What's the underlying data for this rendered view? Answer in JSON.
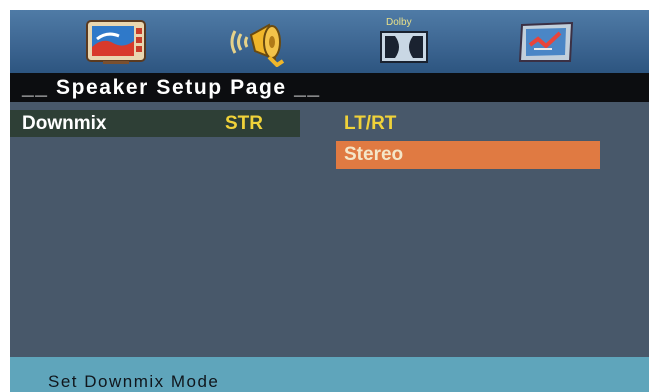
{
  "tabs": [
    {
      "name": "general-setup",
      "icon": "tv-icon"
    },
    {
      "name": "audio-setup",
      "icon": "speaker-icon"
    },
    {
      "name": "dolby-setup",
      "icon": "dolby-icon",
      "label": "Dolby"
    },
    {
      "name": "preference-setup",
      "icon": "checklist-icon"
    }
  ],
  "page": {
    "title": "__ Speaker Setup Page __"
  },
  "settings": [
    {
      "label": "Downmix",
      "value": "STR"
    }
  ],
  "options": [
    {
      "label": "LT/RT",
      "selected": false
    },
    {
      "label": "Stereo",
      "selected": true
    }
  ],
  "status": {
    "text": "Set Downmix Mode"
  },
  "colors": {
    "background": "#48586a",
    "tab_bar": "#3d6692",
    "title_bar": "#0c0d10",
    "row_highlight": "#2e3f36",
    "value_text": "#f0d23a",
    "selected_option": "#e07a42",
    "status_bar": "#5fa5bb"
  }
}
